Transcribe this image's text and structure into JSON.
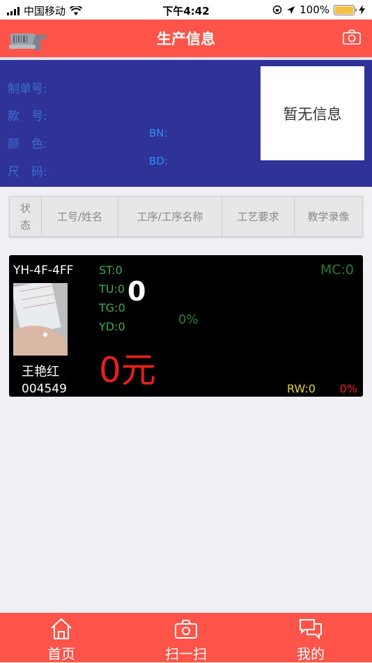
{
  "status_bar": {
    "carrier": "中国移动",
    "time": "下午4:42",
    "battery": "100%"
  },
  "header": {
    "title": "生产信息"
  },
  "info": {
    "labels": [
      "制单号:",
      "款　号:",
      "颜　色:",
      "尺　码:"
    ],
    "bn_label": "BN:",
    "bd_label": "BD:",
    "no_info": "暂无信息"
  },
  "table": {
    "status_col": [
      "状",
      "态"
    ],
    "columns": [
      "工号/姓名",
      "工序/工序名称",
      "工艺要求",
      "教学录像"
    ]
  },
  "card": {
    "code": "YH-4F-4FF",
    "name": "王艳红",
    "id": "004549",
    "stats": [
      "ST:0",
      "TU:0",
      "TG:0",
      "YD:0"
    ],
    "big_value": "0",
    "percent_mid": "0%",
    "mc": "MC:0",
    "amount": "0元",
    "rw": "RW:0",
    "percent_red": "0%"
  },
  "tabs": [
    {
      "label": "首页",
      "icon": "home-icon"
    },
    {
      "label": "扫一扫",
      "icon": "camera-icon"
    },
    {
      "label": "我的",
      "icon": "chat-icon"
    }
  ],
  "colors": {
    "accent": "#ff5449",
    "info_panel": "#2f3296"
  }
}
